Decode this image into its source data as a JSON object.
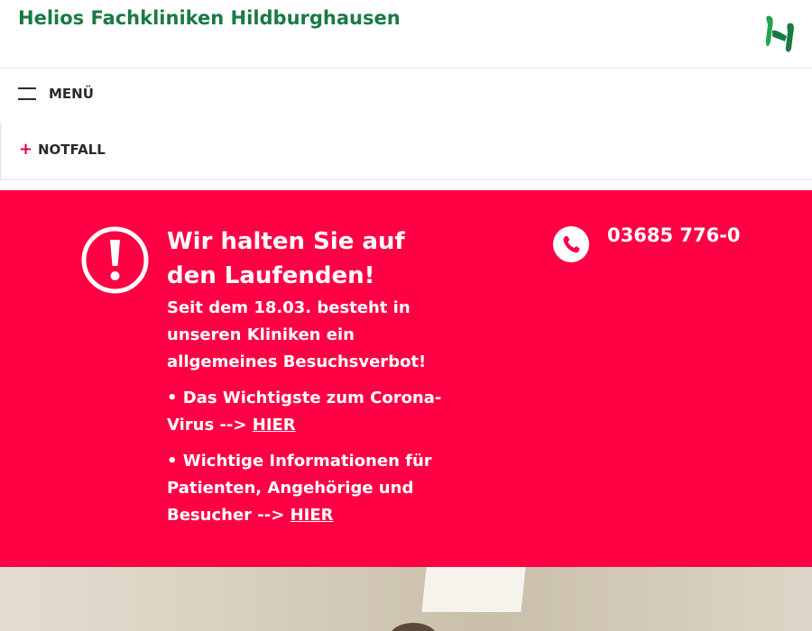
{
  "header": {
    "title": "Helios Fachkliniken Hildburghausen",
    "logo_icon": "helios-logo-icon"
  },
  "nav": {
    "menu_label": "MENÜ",
    "menu_icon": "hamburger-icon",
    "emergency_label": "NOTFALL",
    "emergency_icon": "plus-icon"
  },
  "alert": {
    "icon": "exclamation-icon",
    "heading": "Wir halten Sie auf den Laufenden!",
    "intro": "Seit dem 18.03. besteht in unseren Kliniken ein allgemeines Besuchsverbot!",
    "bullets": [
      {
        "text": "• Das Wichtigste zum Corona-Virus --> ",
        "link": "HIER"
      },
      {
        "text": "• Wichtige Informationen für Patienten, Angehörige und Besucher --> ",
        "link": "HIER"
      }
    ],
    "phone_icon": "phone-icon",
    "phone": "03685 776-0"
  },
  "colors": {
    "brand_green": "#1a7a44",
    "alert_red": "#ff0044",
    "emergency_red": "#e4003f"
  }
}
